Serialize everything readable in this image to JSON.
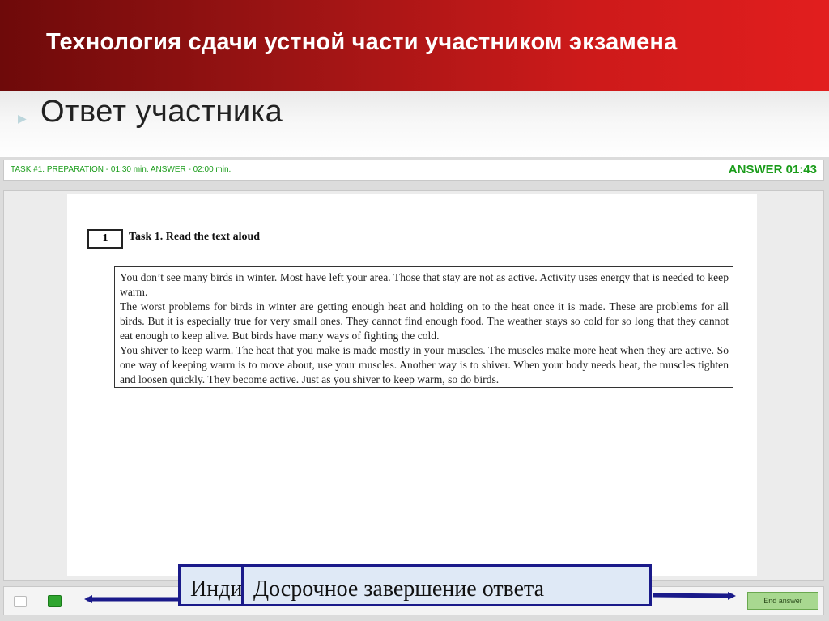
{
  "slide": {
    "title": "Технология сдачи устной части участником экзамена",
    "subtitle": "Ответ участника",
    "bullet_icon": "chevron-right-icon"
  },
  "app": {
    "status": {
      "task_info": "TASK #1. PREPARATION - 01:30 min. ANSWER - 02:00 min.",
      "timer": "ANSWER 01:43"
    },
    "task": {
      "number": "1",
      "title": "Task 1. Read the text aloud",
      "paragraphs": [
        "You don’t see many birds in winter. Most have left your area. Those that stay are not as active. Activity uses energy that is needed to keep warm.",
        "The worst problems for birds in winter are getting enough heat and holding on to the heat once it is made. These are problems for all birds. But it is especially true for very small ones. They cannot find enough food. The weather stays so cold for so long that they cannot eat enough to keep alive. But birds have many ways of fighting the cold.",
        "You shiver to keep warm.  The heat that you make is made mostly in your muscles. The muscles make more heat when they are active. So one way of keeping warm is to move about, use your muscles. Another way is to shiver. When your body needs heat, the muscles tighten and loosen quickly. They become active. Just as you shiver to keep warm, so do birds."
      ]
    },
    "bottom": {
      "end_answer_label": "End answer"
    }
  },
  "callouts": {
    "left_label": "Инди",
    "main_label": "Досрочное завершение ответа"
  },
  "colors": {
    "title_bar": "#b51818",
    "timer_green": "#1a9c1a",
    "callout_border": "#1a1a8a"
  }
}
